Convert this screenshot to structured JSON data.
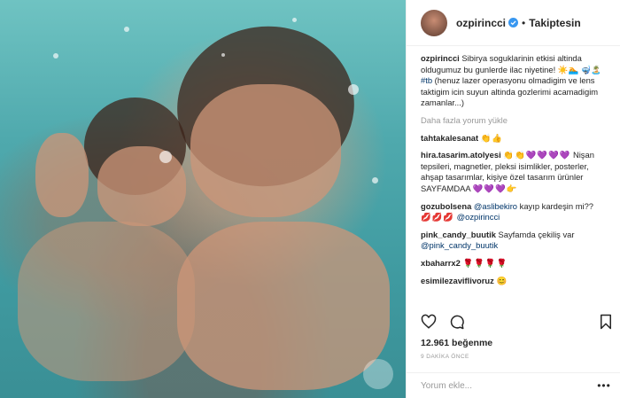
{
  "post": {
    "photo_alt_name": "underwater-photo",
    "header": {
      "username": "ozpirincci",
      "dot": "•",
      "follow_label": "Takiptesin"
    },
    "caption": {
      "username": "ozpirincci",
      "text_1": "Sibirya soguklarinin etkisi altinda oldugumuz bu gunlerde ilac niyetine! ☀️🏊",
      "text_2": "🤿🏝️",
      "hashtag": "#tb",
      "text_3": "(henuz lazer operasyonu olmadigim ve lens taktigim icin suyun altinda gozlerimi acamadigim zamanlar...)"
    },
    "load_more": "Daha fazla yorum yükle",
    "comments": [
      {
        "username": "tahtakalesanat",
        "text": "",
        "emoji": "👏👍"
      },
      {
        "username": "hira.tasarim.atolyesi",
        "text": "Nişan tepsileri, magnetler, pleksi isimlikler, posterler, ahşap tasarımlar, kişiye özel tasarım ürünler SAYFAMDAA",
        "emoji_before": "👏👏💜💜💜💜",
        "emoji": "💜💜💜👉"
      },
      {
        "username": "gozubolsena",
        "mention": "@aslibekiro",
        "text": "kayıp kardeşin mi??",
        "emoji": "💋💋💋",
        "mention_2": "@ozpirincci"
      },
      {
        "username": "pink_candy_buutik",
        "text": "Sayfamda çekiliş var",
        "mention": "@pink_candy_buutik"
      },
      {
        "username": "xbaharrx2",
        "text": "",
        "emoji": "🌹🌹🌹🌹"
      },
      {
        "username": "esimilezaviflivoruz",
        "text": "",
        "emoji": "😊"
      }
    ],
    "likes": "12.961 beğenme",
    "time": "9 DAKİKA ÖNCE",
    "comment_placeholder": "Yorum ekle...",
    "more_label": "•••"
  },
  "colors": {
    "text": "#262626",
    "muted": "#999999",
    "link": "#003569",
    "verified": "#3897f0",
    "border": "#efefef"
  }
}
